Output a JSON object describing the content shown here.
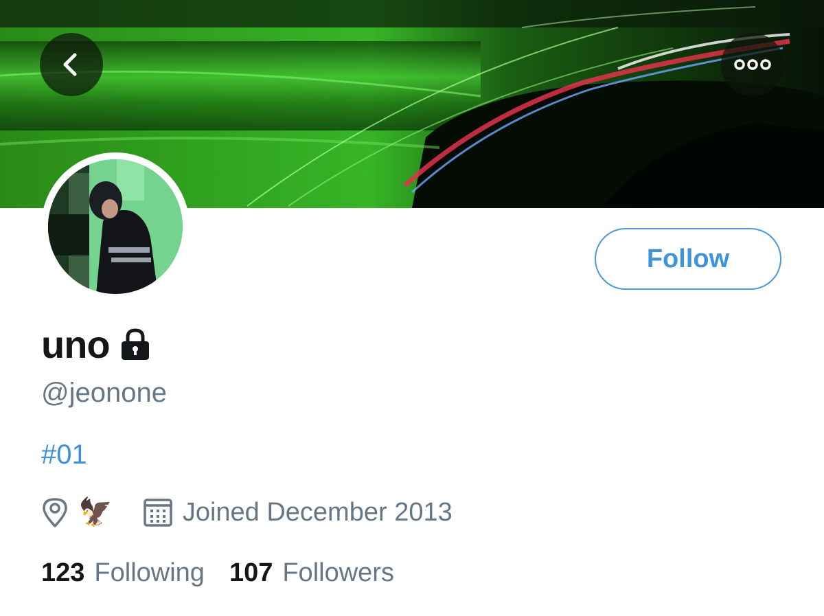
{
  "header": {
    "back_icon": "chevron-left-icon",
    "more_icon": "more-dots-icon"
  },
  "profile": {
    "display_name": "uno",
    "protected_icon": "lock-icon",
    "handle": "@jeonone",
    "bio": "#01",
    "location_icon": "location-pin-icon",
    "location": "🦅",
    "calendar_icon": "calendar-icon",
    "joined": "Joined December 2013",
    "follow_label": "Follow"
  },
  "stats": {
    "following_count": "123",
    "following_label": "Following",
    "followers_count": "107",
    "followers_label": "Followers"
  },
  "colors": {
    "accent": "#3f93d8",
    "secondary_text": "#657786",
    "primary_text": "#14171a",
    "banner_green": "#2fa81e"
  }
}
